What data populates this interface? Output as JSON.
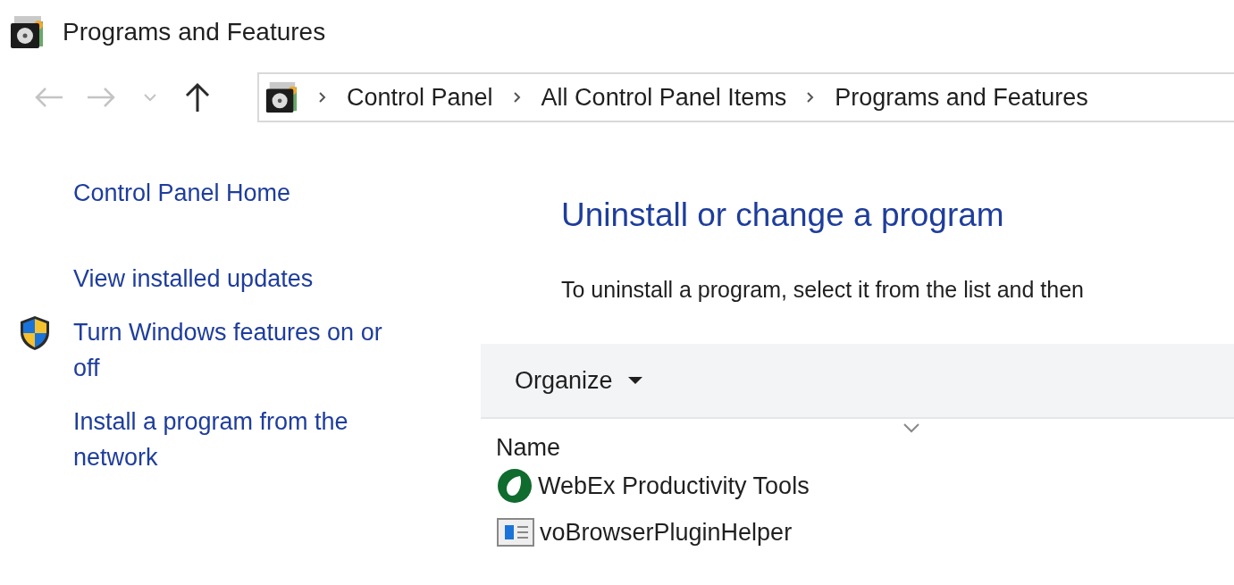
{
  "window": {
    "title": "Programs and Features"
  },
  "navigation": [
    {
      "kind": "back",
      "disabled": true
    },
    {
      "kind": "forward",
      "disabled": true
    },
    {
      "kind": "recent",
      "disabled": true
    },
    {
      "kind": "up",
      "disabled": false
    }
  ],
  "address_bar": {
    "breadcrumbs": [
      "Control Panel",
      "All Control Panel Items",
      "Programs and Features"
    ]
  },
  "sidebar": {
    "items": [
      {
        "label": "Control Panel Home",
        "kind": "plain"
      },
      {
        "label": "View installed updates",
        "kind": "plain"
      },
      {
        "label": "Turn Windows features on or off",
        "kind": "shield"
      },
      {
        "label": "Install a program from the network",
        "kind": "plain"
      }
    ]
  },
  "main": {
    "heading": "Uninstall or change a program",
    "description": "To uninstall a program, select it from the list and then"
  },
  "toolbar": {
    "organize": "Organize"
  },
  "table": {
    "columns": [
      "Name"
    ],
    "rows": [
      {
        "name": "WebEx Productivity Tools",
        "kind": "webex"
      },
      {
        "name": "voBrowserPluginHelper",
        "kind": "window"
      }
    ]
  }
}
